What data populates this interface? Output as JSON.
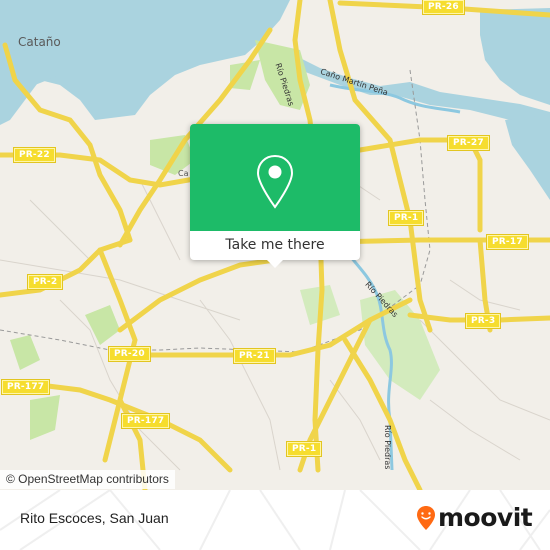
{
  "map": {
    "place_labels": {
      "catano": "Cataño",
      "canal_partial": "Ca"
    },
    "water_labels": {
      "cano_martin_pena": "Caño Martín Peña",
      "rio_piedras_north": "Río Piedras",
      "rio_piedras_mid": "Río Piedras",
      "rio_piedras_south": "Río Piedras"
    },
    "road_shields": {
      "pr22": "PR-22",
      "pr26": "PR-26",
      "pr27": "PR-27",
      "pr1_north": "PR-1",
      "pr17": "PR-17",
      "pr2": "PR-2",
      "pr3": "PR-3",
      "pr20": "PR-20",
      "pr21": "PR-21",
      "pr177_west": "PR-177",
      "pr177_south": "PR-177",
      "pr1_south": "PR-1"
    },
    "colors": {
      "land": "#f2efe9",
      "water": "#aad3df",
      "park": "#c8e6a6",
      "road_major": "#f6dd4c",
      "popup_green": "#1dbb68"
    }
  },
  "popup": {
    "icon": "location-pin-icon",
    "button_label": "Take me there"
  },
  "attribution": {
    "text": "© OpenStreetMap contributors"
  },
  "footer": {
    "location": "Rito Escoces, San Juan",
    "brand": "moovit",
    "brand_color": "#ff6a13"
  }
}
